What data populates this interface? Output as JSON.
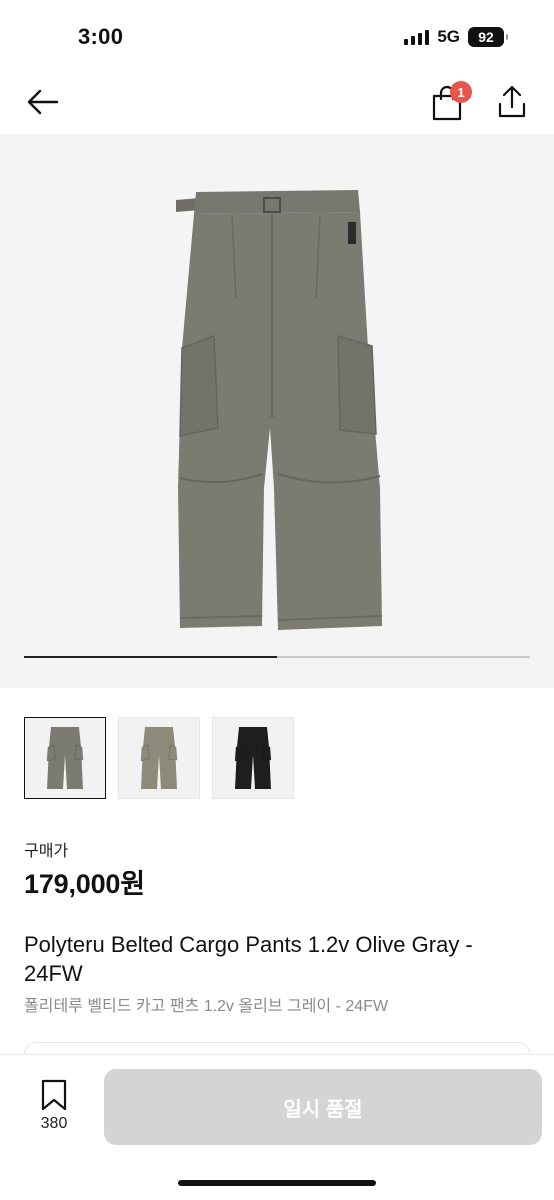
{
  "status": {
    "time": "3:00",
    "network": "5G",
    "battery": "92"
  },
  "nav": {
    "cart_count": "1"
  },
  "gallery": {
    "progress": 0.5,
    "thumbnail_colors": [
      "#7b7b72",
      "#8c8a78",
      "#1e1e1e"
    ]
  },
  "price": {
    "label": "구매가",
    "value": "179,000원"
  },
  "product": {
    "title_en": "Polyteru Belted Cargo Pants 1.2v Olive Gray - 24FW",
    "title_ko": "폴리테루 벨티드 카고 팬츠 1.2v 올리브 그레이 - 24FW"
  },
  "bottom": {
    "wish_count": "380",
    "buy_label": "일시 품절"
  },
  "colors": {
    "badge": "#e8554b",
    "buy_disabled": "#d4d4d4",
    "hero_bg": "#f4f4f4"
  },
  "icons": [
    "back-arrow-icon",
    "shopping-bag-icon",
    "share-icon",
    "bookmark-icon"
  ]
}
